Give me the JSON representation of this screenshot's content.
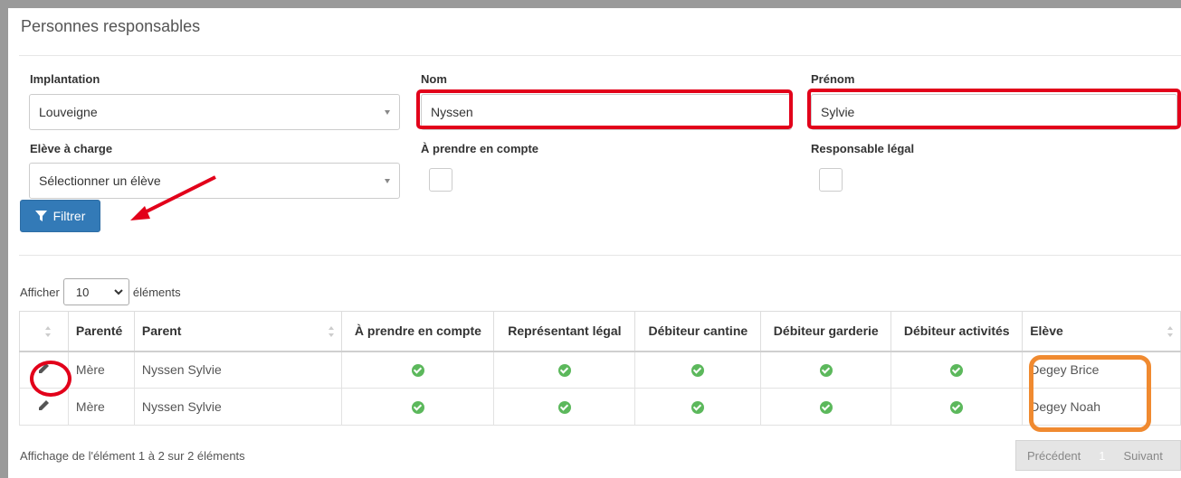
{
  "page": {
    "title": "Personnes responsables"
  },
  "filters": {
    "implantation": {
      "label": "Implantation",
      "value": "Louveigne"
    },
    "nom": {
      "label": "Nom",
      "value": "Nyssen"
    },
    "prenom": {
      "label": "Prénom",
      "value": "Sylvie"
    },
    "eleve": {
      "label": "Elève à charge",
      "value": "Sélectionner un élève"
    },
    "a_prendre": {
      "label": "À prendre en compte"
    },
    "responsable": {
      "label": "Responsable légal"
    },
    "filter_button": "Filtrer"
  },
  "length": {
    "prefix": "Afficher",
    "value": "10",
    "suffix": "éléments"
  },
  "table": {
    "headers": [
      "Parenté",
      "Parent",
      "À prendre en compte",
      "Représentant légal",
      "Débiteur cantine",
      "Débiteur garderie",
      "Débiteur activités",
      "Elève"
    ],
    "rows": [
      {
        "parente": "Mère",
        "parent": "Nyssen Sylvie",
        "eleve": "Degey Brice"
      },
      {
        "parente": "Mère",
        "parent": "Nyssen Sylvie",
        "eleve": "Degey Noah"
      }
    ]
  },
  "footer": {
    "info": "Affichage de l'élément 1 à 2 sur 2 éléments",
    "prev": "Précédent",
    "page": "1",
    "next": "Suivant"
  },
  "colors": {
    "primary": "#337ab7",
    "highlight_red": "#e2001a",
    "highlight_orange": "#f08a30",
    "check_green": "#5cb85c"
  }
}
